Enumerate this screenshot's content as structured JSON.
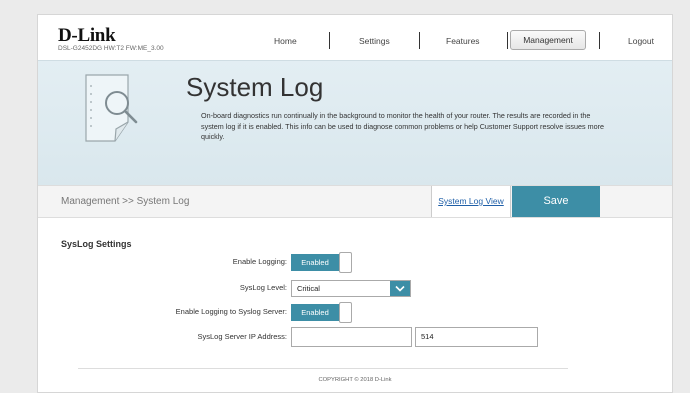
{
  "header": {
    "logo": "D-Link",
    "model_info": "DSL-G2452DG   HW:T2   FW:ME_3.00",
    "nav": {
      "home": "Home",
      "settings": "Settings",
      "features": "Features",
      "management": "Management",
      "logout": "Logout"
    }
  },
  "banner": {
    "icon": "magnifier-document-icon",
    "title": "System Log",
    "description": "On-board diagnostics run continually in the background to monitor the health of your router. The results are recorded in the system log if it is enabled. This info can be used to diagnose common problems or help Customer Support resolve issues more quickly."
  },
  "actionbar": {
    "breadcrumb": "Management >> System Log",
    "log_view_link": "System Log View",
    "save_label": "Save"
  },
  "form": {
    "section_title": "SysLog Settings",
    "enable_logging_label": "Enable Logging:",
    "enable_logging_value": "Enabled",
    "syslog_level_label": "SysLog Level:",
    "syslog_level_value": "Critical",
    "enable_server_label": "Enable Logging to Syslog Server:",
    "enable_server_value": "Enabled",
    "server_ip_label": "SysLog Server IP Address:",
    "server_ip_value": "",
    "server_port_value": "514"
  },
  "footer": {
    "copyright": "COPYRIGHT © 2018 D-Link"
  },
  "colors": {
    "accent": "#3d8ea6",
    "link": "#1f5fa8",
    "banner_bg": "#dde9ef"
  }
}
